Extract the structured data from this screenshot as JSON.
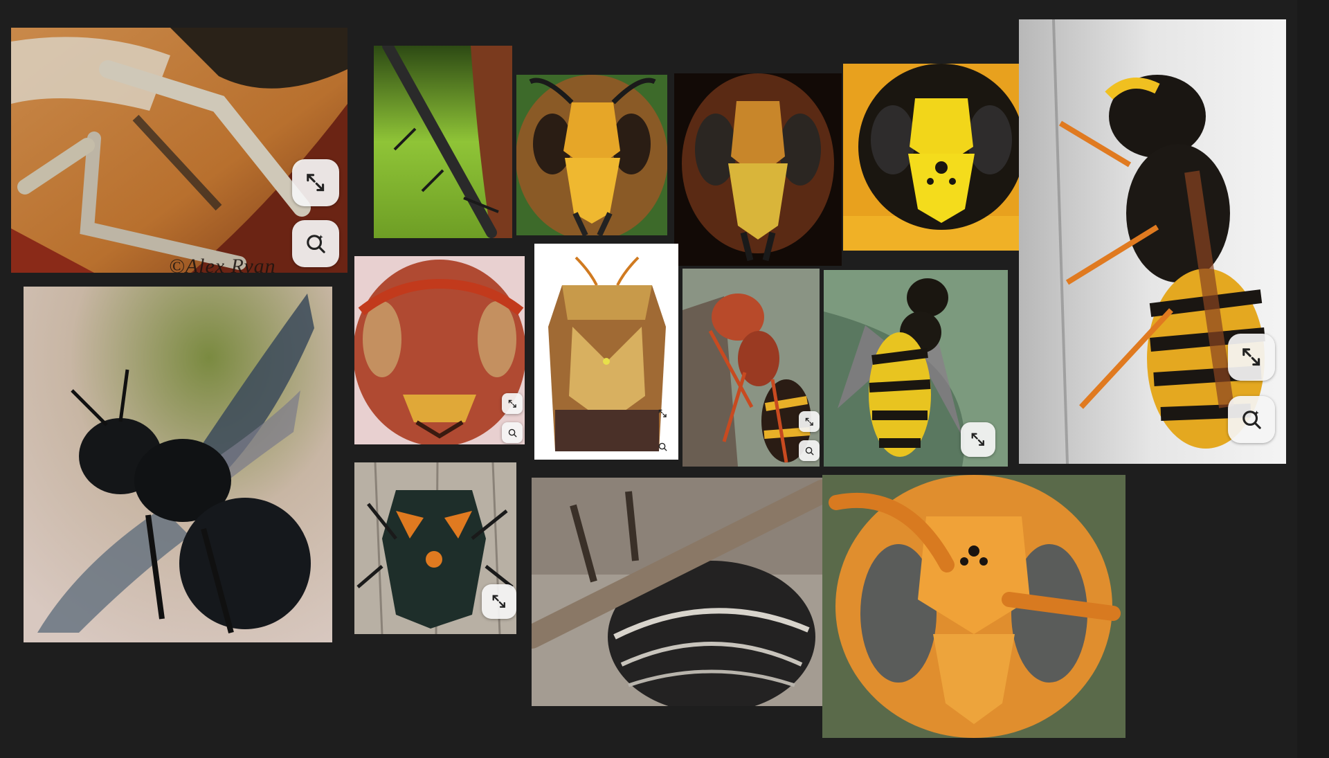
{
  "gallery": {
    "title": "",
    "background_color": "#1e1e1e",
    "images": [
      {
        "id": "img-1",
        "subject": "spider-leg-closeup",
        "has_expand": true,
        "has_visual_search": true,
        "watermark": "©Alex Ryan"
      },
      {
        "id": "img-2",
        "subject": "insect-leg-on-green",
        "has_expand": false,
        "has_visual_search": false
      },
      {
        "id": "img-3",
        "subject": "hornet-face-front",
        "has_expand": false,
        "has_visual_search": false
      },
      {
        "id": "img-4",
        "subject": "hornet-face-dark",
        "has_expand": false,
        "has_visual_search": false
      },
      {
        "id": "img-5",
        "subject": "yellowjacket-face",
        "has_expand": false,
        "has_visual_search": false
      },
      {
        "id": "img-6",
        "subject": "yellowjacket-side-on-wall",
        "has_expand": true,
        "has_visual_search": true
      },
      {
        "id": "img-7",
        "subject": "carpenter-bee-flying",
        "has_expand": false,
        "has_visual_search": false
      },
      {
        "id": "img-8",
        "subject": "red-wasp-face",
        "has_expand": true,
        "has_visual_search": true
      },
      {
        "id": "img-9",
        "subject": "shield-bug-white-background",
        "has_expand": true,
        "has_visual_search": true
      },
      {
        "id": "img-10",
        "subject": "paper-wasp-on-nest",
        "has_expand": true,
        "has_visual_search": true
      },
      {
        "id": "img-11",
        "subject": "yellowjacket-on-leaf",
        "has_expand": true,
        "has_visual_search": false
      },
      {
        "id": "img-12",
        "subject": "stink-bug-on-wood",
        "has_expand": true,
        "has_visual_search": false
      },
      {
        "id": "img-13",
        "subject": "bee-abdomen-on-twig",
        "has_expand": false,
        "has_visual_search": false
      },
      {
        "id": "img-14",
        "subject": "giant-hornet-face",
        "has_expand": false,
        "has_visual_search": false
      }
    ]
  },
  "icons": {
    "expand": "expand-icon",
    "visual_search": "visual-search-icon"
  },
  "colors": {
    "button_bg": "#f5f5f5",
    "icon_stroke": "#222222"
  }
}
